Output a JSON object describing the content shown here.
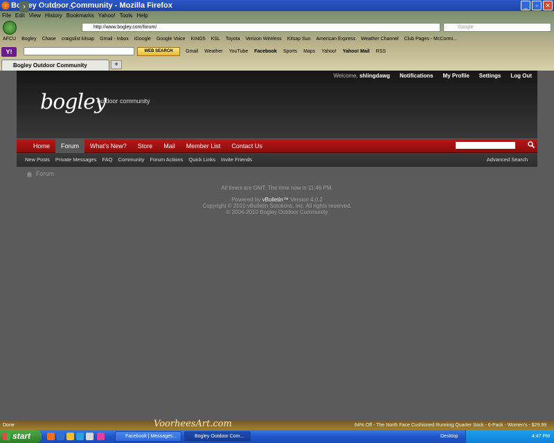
{
  "window": {
    "title": "Bogley Outdoor Community - Mozilla Firefox"
  },
  "menu": [
    "File",
    "Edit",
    "View",
    "History",
    "Bookmarks",
    "Yahoo!",
    "Tools",
    "Help"
  ],
  "address": {
    "url": "http://www.bogley.com/forum/",
    "search_placeholder": "Google"
  },
  "bookmarks": [
    "AFCU",
    "Bogley",
    "Chase",
    "craigslist kitsap",
    "Gmail - Inbox",
    "iGoogle",
    "Google Voice",
    "KING5",
    "KSL",
    "Toyota",
    "Verizon Wireless",
    "Kitsap Sun",
    "American Express",
    "Weather Channel",
    "Club Pages - McCormi..."
  ],
  "yahoo_toolbar": {
    "search_button": "WEB SEARCH",
    "items": [
      "Gmail",
      "Weather",
      "YouTube",
      "Facebook",
      "Sports",
      "Maps",
      "Yahoo!",
      "Yahoo! Mail",
      "RSS"
    ]
  },
  "tab": {
    "label": "Bogley Outdoor Community",
    "new_tab": "+"
  },
  "site": {
    "welcome": "Welcome,",
    "username": "shlingdawg",
    "top_links": [
      "Notifications",
      "My Profile",
      "Settings",
      "Log Out"
    ],
    "logo": "bogley",
    "tagline": "outdoor community",
    "nav": [
      "Home",
      "Forum",
      "What's New?",
      "Store",
      "Mail",
      "Member List",
      "Contact Us"
    ],
    "subnav": [
      "New Posts",
      "Private Messages",
      "FAQ",
      "Community",
      "Forum Actions",
      "Quick Links",
      "Invite Friends"
    ],
    "advanced_search": "Advanced Search",
    "breadcrumb": "Forum",
    "footer": {
      "time_prefix": "All times are GMT. The time now is",
      "time": "11:46 PM.",
      "powered_prefix": "Powered by",
      "powered_brand": "vBulletin™",
      "powered_version": "Version 4.0.2",
      "copyright1": "Copyright © 2010 vBulletin Solutions, Inc. All rights reserved.",
      "copyright2": "© 2004-2010 Bogley Outdoor Community"
    }
  },
  "status": {
    "text": "Done",
    "art": "VoorheesArt.com",
    "deal": "64% Off - The North Face Cushioned Running Quarter Sock - 6-Pack - Women's - $29.99"
  },
  "taskbar": {
    "start": "start",
    "tasks": [
      "Facebook | Messages...",
      "Bogley Outdoor Com..."
    ],
    "desktop": "Desktop",
    "clock": "4:47 PM"
  },
  "colors": {
    "nav_red": "#b81818",
    "header_dark": "#1a1a1a",
    "page_bg": "#5b5b5b"
  }
}
